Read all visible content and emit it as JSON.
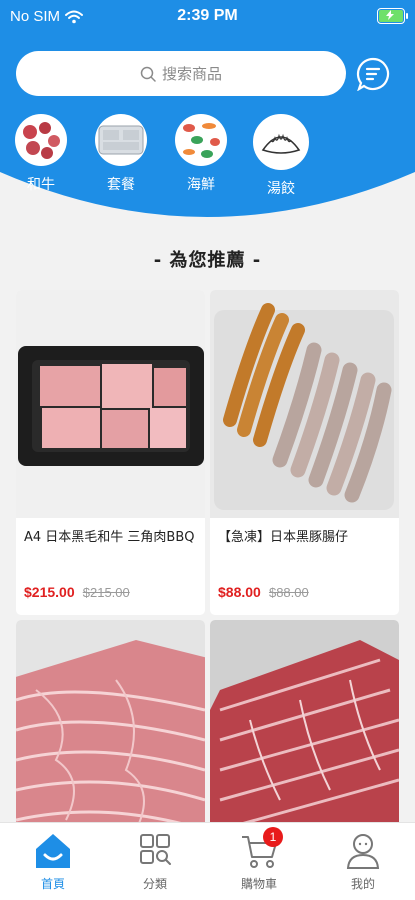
{
  "status_bar": {
    "carrier": "No SIM",
    "time": "2:39 PM"
  },
  "search": {
    "placeholder": "搜索商品"
  },
  "categories": [
    {
      "label": "和牛"
    },
    {
      "label": "套餐"
    },
    {
      "label": "海鮮"
    },
    {
      "label": "湯餃"
    }
  ],
  "section": {
    "title": "- 為您推薦 -"
  },
  "products": [
    {
      "name": "A4 日本黑毛和牛 三角肉BBQ",
      "price": "$215.00",
      "original_price": "$215.00"
    },
    {
      "name": "【急凍】日本黑豚腸仔",
      "price": "$88.00",
      "original_price": "$88.00"
    },
    {
      "name": "",
      "price": "",
      "original_price": ""
    },
    {
      "name": "",
      "price": "",
      "original_price": ""
    }
  ],
  "tabbar": {
    "items": [
      {
        "label": "首頁"
      },
      {
        "label": "分類"
      },
      {
        "label": "購物車",
        "badge": "1"
      },
      {
        "label": "我的"
      }
    ]
  },
  "colors": {
    "brand": "#1e8ee6",
    "price": "#e02020",
    "badge": "#e81b1b"
  }
}
